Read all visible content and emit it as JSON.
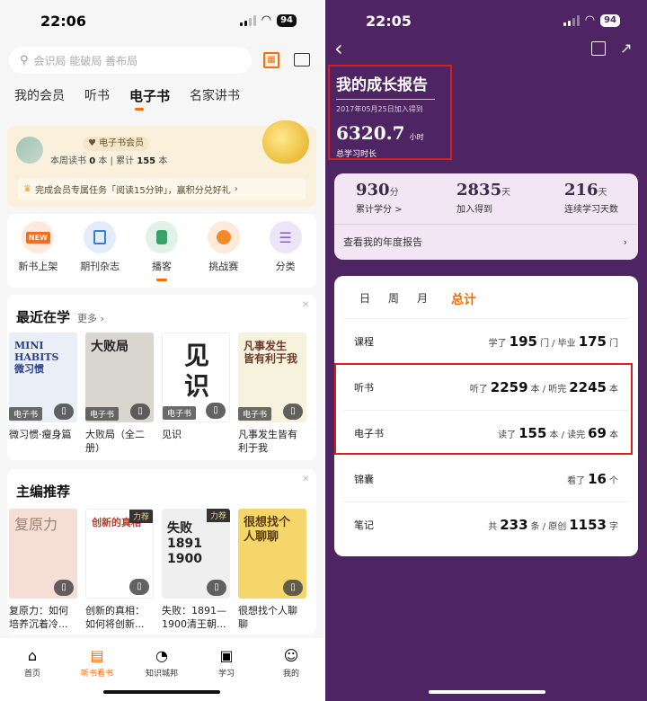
{
  "left": {
    "status": {
      "time": "22:06",
      "battery": "94"
    },
    "search": {
      "placeholder": "会识局 能破局 善布局"
    },
    "tabs": [
      "我的会员",
      "听书",
      "电子书",
      "名家讲书"
    ],
    "vip": {
      "badge": "电子书会员",
      "week_label": "本周读书",
      "week_value": "0",
      "week_unit": "本",
      "total_label": "累计",
      "total_value": "155",
      "total_unit": "本",
      "task": "完成会员专属任务「阅读15分钟」，赢积分兑好礼"
    },
    "quick": [
      {
        "label": "新书上架",
        "icon": "NEW",
        "color": "#f26d21"
      },
      {
        "label": "期刊杂志",
        "icon": "magazine-icon",
        "color": "#3b7bd6"
      },
      {
        "label": "播客",
        "icon": "podcast-icon",
        "color": "#3aa36b"
      },
      {
        "label": "挑战赛",
        "icon": "medal-icon",
        "color": "#f28a2a"
      },
      {
        "label": "分类",
        "icon": "list-icon",
        "color": "#8a63d2"
      }
    ],
    "recent": {
      "title": "最近在学",
      "more": "更多",
      "books": [
        {
          "title": "微习惯·瘦身篇",
          "cover_text": "MINI HABITS 微习惯",
          "tag": "电子书",
          "bg": "#e9eef7"
        },
        {
          "title": "大败局（全二册）",
          "cover_text": "大败局",
          "tag": "电子书",
          "bg": "#d9d6cf"
        },
        {
          "title": "见识",
          "cover_text": "见识",
          "tag": "电子书",
          "bg": "#ffffff"
        },
        {
          "title": "凡事发生皆有利于我",
          "cover_text": "凡事发生 皆有利于我",
          "tag": "电子书",
          "bg": "#f7f2dd"
        }
      ]
    },
    "editor": {
      "title": "主编推荐",
      "books": [
        {
          "title": "复原力：如何培养沉着冷...",
          "cover_text": "复原力",
          "bg": "#f5ded5",
          "badge": ""
        },
        {
          "title": "创新的真相：如何将创新...",
          "cover_text": "创新的真相",
          "bg": "#ffffff",
          "badge": "力荐"
        },
        {
          "title": "失败：1891—1900清王朝...",
          "cover_text": "失败 1891 1900",
          "bg": "#efefef",
          "badge": "力荐"
        },
        {
          "title": "很想找个人聊聊",
          "cover_text": "很想找个人聊聊",
          "bg": "#f5d66a",
          "badge": ""
        }
      ]
    },
    "nav": [
      {
        "label": "首页",
        "icon": "⌂"
      },
      {
        "label": "听书看书",
        "icon": "▤"
      },
      {
        "label": "知识城邦",
        "icon": "◔"
      },
      {
        "label": "学习",
        "icon": "▣"
      },
      {
        "label": "我的",
        "icon": "☺"
      }
    ]
  },
  "right": {
    "status": {
      "time": "22:05",
      "battery": "94"
    },
    "report": {
      "title": "我的成长报告",
      "joined": "2017年05月25日加入得到",
      "hours": "6320.7",
      "hours_unit": "小时",
      "hours_label": "总学习时长"
    },
    "stats": [
      {
        "num": "930",
        "unit": "分",
        "label": "累计学分 >"
      },
      {
        "num": "2835",
        "unit": "天",
        "label": "加入得到"
      },
      {
        "num": "216",
        "unit": "天",
        "label": "连续学习天数"
      }
    ],
    "annual": "查看我的年度报告",
    "period_tabs": [
      "日",
      "周",
      "月",
      "总计"
    ],
    "rows": [
      {
        "name": "课程",
        "p1": "学了",
        "v1": "195",
        "u1": "门 / 毕业",
        "v2": "175",
        "u2": "门"
      },
      {
        "name": "听书",
        "p1": "听了",
        "v1": "2259",
        "u1": "本 / 听完",
        "v2": "2245",
        "u2": "本"
      },
      {
        "name": "电子书",
        "p1": "读了",
        "v1": "155",
        "u1": "本 / 读完",
        "v2": "69",
        "u2": "本"
      },
      {
        "name": "锦囊",
        "p1": "看了",
        "v1": "16",
        "u1": "个",
        "v2": "",
        "u2": ""
      },
      {
        "name": "笔记",
        "p1": "共",
        "v1": "233",
        "u1": "条 / 原创",
        "v2": "1153",
        "u2": "字"
      }
    ]
  }
}
